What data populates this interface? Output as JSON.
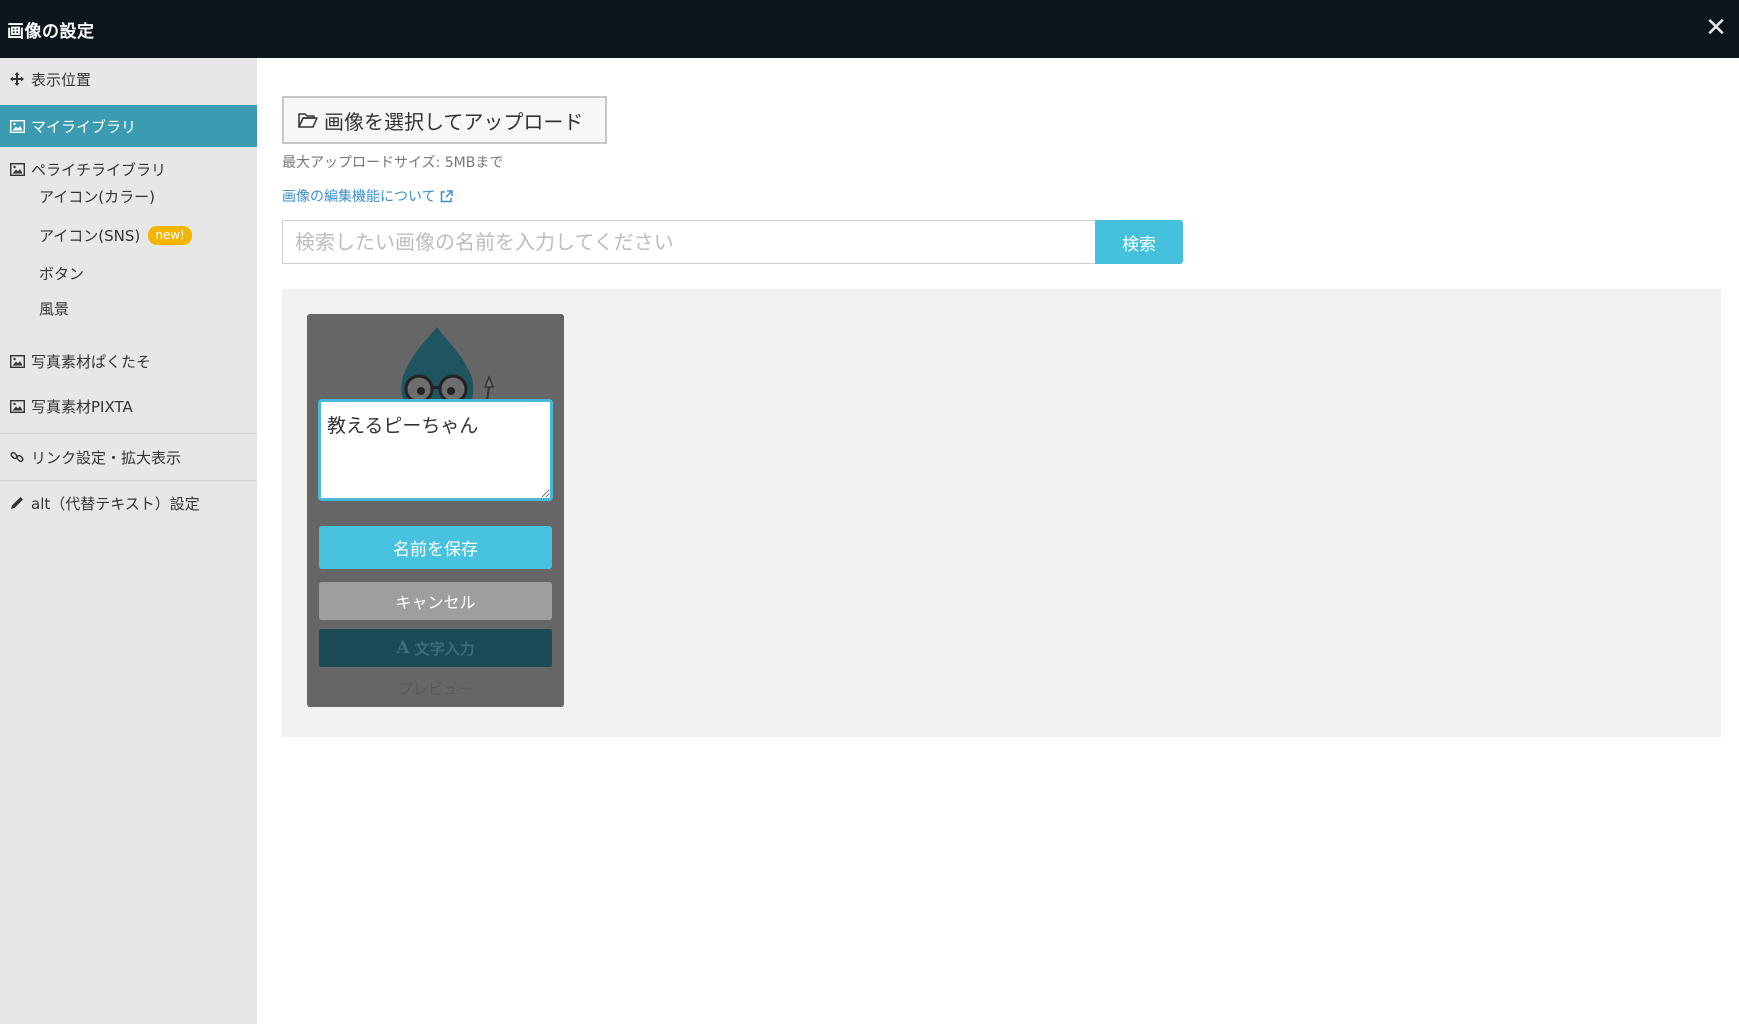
{
  "window": {
    "title": "画像の設定",
    "close_glyph": "✕"
  },
  "sidebar": {
    "items": [
      {
        "label": "表示位置",
        "icon": "move-icon"
      },
      {
        "label": "マイライブラリ",
        "icon": "image-icon",
        "active": true
      },
      {
        "label": "ペライチライブラリ",
        "icon": "image-icon"
      },
      {
        "label": "写真素材ぱくたそ",
        "icon": "image-icon"
      },
      {
        "label": "写真素材PIXTA",
        "icon": "image-icon"
      },
      {
        "label": "リンク設定・拡大表示",
        "icon": "link-icon"
      },
      {
        "label": "alt（代替テキスト）設定",
        "icon": "pencil-icon"
      }
    ],
    "subitems": [
      {
        "label": "アイコン(カラー)"
      },
      {
        "label": "アイコン(SNS)",
        "badge": "new!"
      },
      {
        "label": "ボタン"
      },
      {
        "label": "風景"
      }
    ],
    "active_color": "#3b9cb1",
    "badge_color": "#f4b400"
  },
  "main": {
    "upload_label": "画像を選択してアップロード",
    "upload_note": "最大アップロードサイズ: 5MBまで",
    "help_link": "画像の編集機能について",
    "search": {
      "placeholder": "検索したい画像の名前を入力してください",
      "value": "",
      "button": "検索"
    },
    "card": {
      "name_value": "教えるピーちゃん",
      "save_label": "名前を保存",
      "cancel_label": "キャンセル",
      "text_input_label": "文字入力",
      "text_icon": "A",
      "preview_label": "プレビュー"
    },
    "accent_color": "#45c0dc"
  }
}
